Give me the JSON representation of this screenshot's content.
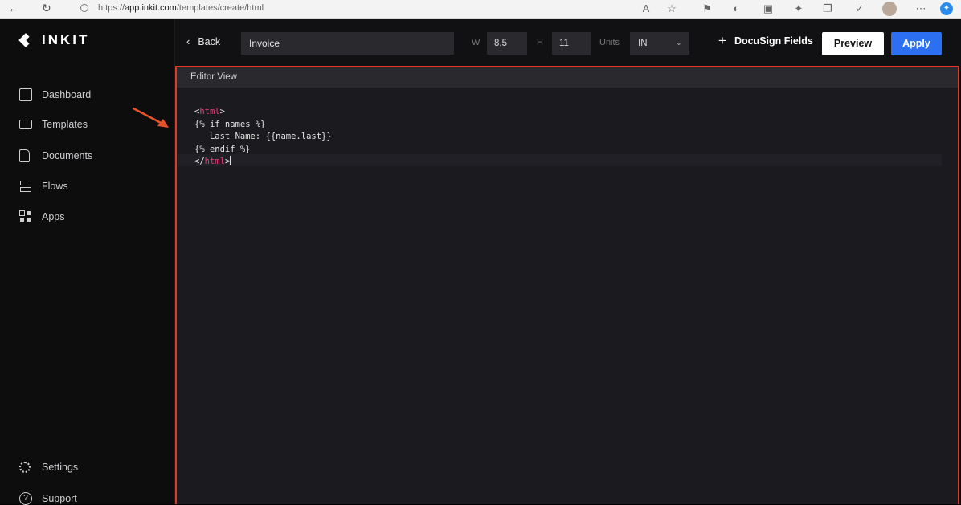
{
  "browser": {
    "url_prefix": "https://",
    "url_host": "app.inkit.com",
    "url_path": "/templates/create/html"
  },
  "sidebar": {
    "logo": "INKIT",
    "items": [
      {
        "label": "Dashboard",
        "icon": "dashboard-icon"
      },
      {
        "label": "Templates",
        "icon": "templates-icon"
      },
      {
        "label": "Documents",
        "icon": "document-icon"
      },
      {
        "label": "Flows",
        "icon": "flows-icon"
      },
      {
        "label": "Apps",
        "icon": "apps-icon"
      }
    ],
    "bottom_items": [
      {
        "label": "Settings",
        "icon": "gear-icon"
      },
      {
        "label": "Support",
        "icon": "help-icon"
      }
    ]
  },
  "toolbar": {
    "back_label": "Back",
    "template_name": "Invoice",
    "width_label": "W",
    "width_value": "8.5",
    "height_label": "H",
    "height_value": "11",
    "units_label": "Units",
    "units_value": "IN",
    "docusign_label": "DocuSign Fields",
    "preview_label": "Preview",
    "apply_label": "Apply"
  },
  "editor": {
    "title": "Editor View",
    "lines": {
      "l1_open": "<",
      "l1_tag": "html",
      "l1_close": ">",
      "l2": "{% if names %}",
      "l3": "   Last Name: {{name.last}}",
      "l4": "{% endif %}",
      "l5_open": "</",
      "l5_tag": "html",
      "l5_close": ">"
    }
  },
  "colors": {
    "accent_blue": "#2c6ff0",
    "highlight_red": "#e23a2a",
    "tag_pink": "#e0407a"
  }
}
